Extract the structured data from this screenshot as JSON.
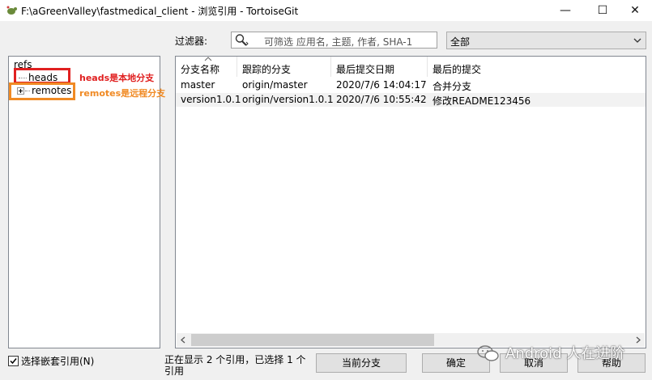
{
  "window": {
    "title": "F:\\aGreenValley\\fastmedical_client - 浏览引用 - TortoiseGit",
    "min_glyph": "—",
    "max_glyph": "☐",
    "close_glyph": "✕"
  },
  "filter": {
    "label": "过滤器:",
    "placeholder": "可筛选 应用名, 主题, 作者, SHA-1",
    "scope_value": "全部"
  },
  "tree": {
    "root": "refs",
    "items": [
      {
        "label": "heads"
      },
      {
        "label": "remotes"
      }
    ]
  },
  "annotations": {
    "heads_note": "heads是本地分支",
    "remotes_note": "remotes是远程分支",
    "heads_color": "#e02020",
    "remotes_color": "#f08a24"
  },
  "table": {
    "columns": [
      "分支名称",
      "跟踪的分支",
      "最后提交日期",
      "最后的提交"
    ],
    "rows": [
      [
        "master",
        "origin/master",
        "2020/7/6 14:04:17",
        "合并分支"
      ],
      [
        "version1.0.1",
        "origin/version1.0.1",
        "2020/7/6 10:55:42",
        "修改README123456"
      ]
    ]
  },
  "footer": {
    "checkbox_label": "选择嵌套引用(N)",
    "checkbox_checked": true,
    "status": "正在显示 2 个引用，已选择 1 个引用",
    "buttons": {
      "current_branch": "当前分支",
      "ok": "确定",
      "cancel": "取消",
      "help": "帮助"
    }
  },
  "watermark": {
    "text": "Android 人在进阶"
  }
}
